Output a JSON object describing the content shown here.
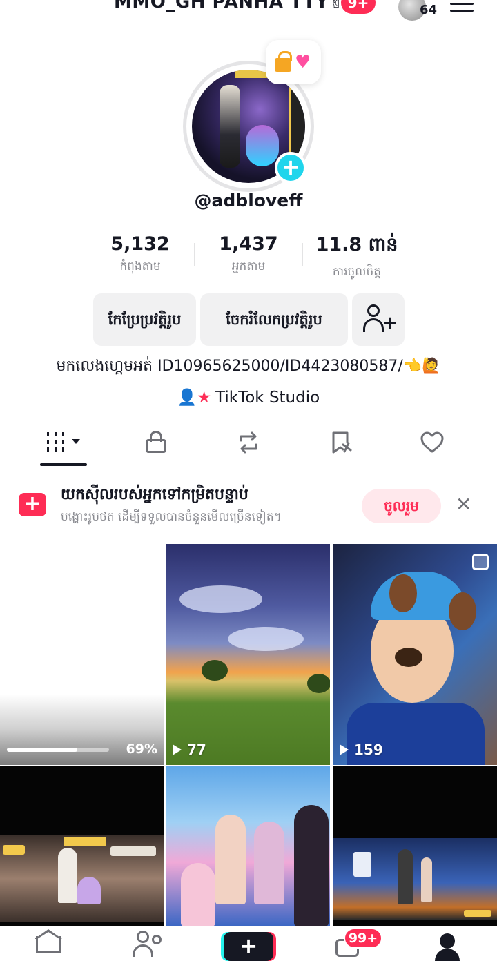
{
  "header": {
    "title": "MMO_GH PANHA TTY✌",
    "notif_badge": "9+",
    "account_count": "64"
  },
  "profile": {
    "note_emojis": "🔐💝",
    "username": "@adbloveff",
    "add_photo_symbol": "+"
  },
  "stats": [
    {
      "value": "5,132",
      "label": "កំពុងតាម"
    },
    {
      "value": "1,437",
      "label": "អ្នកតាម"
    },
    {
      "value": "11.8 ពាន់",
      "label": "ការចូលចិត្ត"
    }
  ],
  "actions": {
    "edit_profile": "កែប្រែប្រវត្តិរូប",
    "share_profile": "ចែករំលែកប្រវត្តិរូប"
  },
  "bio": "មកលេងហ្គេមអត់ ID10965625000/ID4423080587/👈🙋",
  "studio": {
    "icon": "👤★",
    "label": "TikTok Studio"
  },
  "tabs": [
    {
      "name": "videos",
      "icon": "grid-icon"
    },
    {
      "name": "private",
      "icon": "lock-icon"
    },
    {
      "name": "reposts",
      "icon": "repost-icon"
    },
    {
      "name": "favorites",
      "icon": "bookmark-icon"
    },
    {
      "name": "liked",
      "icon": "heart-icon"
    }
  ],
  "promo": {
    "title": "យកស៊ីលរបស់អ្នកទៅកម្រិតបន្ទាប់",
    "subtitle": "បង្ហោះរូបថត ដើម្បីទទួលបានចំនួនមើលច្រើនទៀត។",
    "button": "ចូលរួម",
    "close": "✕"
  },
  "videos": [
    {
      "type": "uploading",
      "progress_percent": 69,
      "progress_label": "69%"
    },
    {
      "type": "video",
      "views": "77"
    },
    {
      "type": "photo",
      "views": "159"
    },
    {
      "type": "video"
    },
    {
      "type": "video"
    },
    {
      "type": "video"
    }
  ],
  "bottom_nav": {
    "create_symbol": "+",
    "inbox_badge": "99+"
  },
  "colors": {
    "accent": "#fe2c55",
    "cyan": "#25f4ee",
    "text": "#161823",
    "muted": "#8a8b91"
  }
}
